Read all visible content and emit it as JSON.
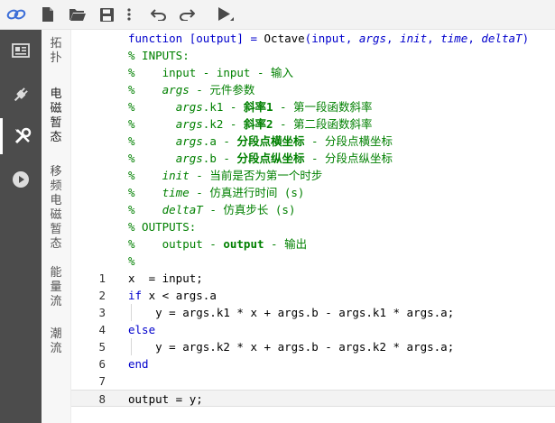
{
  "toolbar": {
    "items": [
      {
        "name": "link-icon"
      },
      {
        "name": "new-file-icon"
      },
      {
        "name": "open-folder-icon"
      },
      {
        "name": "save-icon"
      },
      {
        "name": "more-options-icon"
      },
      {
        "name": "undo-icon"
      },
      {
        "name": "redo-icon"
      },
      {
        "name": "run-icon"
      }
    ]
  },
  "sidebar": {
    "icons": [
      "layout-icon",
      "plug-icon",
      "tools-icon",
      "play-circle-icon"
    ],
    "tabs": [
      "拓扑",
      "电磁暂态",
      "移频电磁暂态",
      "能量流",
      "潮流"
    ]
  },
  "editor": {
    "header": [
      [
        {
          "t": "function [output] = ",
          "c": "kw"
        },
        {
          "t": "Octave",
          "c": "fn"
        },
        {
          "t": "(input, ",
          "c": "kw"
        },
        {
          "t": "args",
          "c": "kwi"
        },
        {
          "t": ", ",
          "c": "kw"
        },
        {
          "t": "init",
          "c": "kwi"
        },
        {
          "t": ", ",
          "c": "kw"
        },
        {
          "t": "time",
          "c": "kwi"
        },
        {
          "t": ", ",
          "c": "kw"
        },
        {
          "t": "deltaT",
          "c": "kwi"
        },
        {
          "t": ")",
          "c": "kw"
        }
      ],
      [
        {
          "t": "% INPUTS:",
          "c": "cm"
        }
      ],
      [
        {
          "t": "%    input - input - 输入",
          "c": "cm"
        }
      ],
      [
        {
          "t": "%    ",
          "c": "cm"
        },
        {
          "t": "args",
          "c": "cmi"
        },
        {
          "t": " - 元件参数",
          "c": "cm"
        }
      ],
      [
        {
          "t": "%      ",
          "c": "cm"
        },
        {
          "t": "args",
          "c": "cmi"
        },
        {
          "t": ".k1 - ",
          "c": "cm"
        },
        {
          "t": "斜率1",
          "c": "cmb"
        },
        {
          "t": " - 第一段函数斜率",
          "c": "cm"
        }
      ],
      [
        {
          "t": "%      ",
          "c": "cm"
        },
        {
          "t": "args",
          "c": "cmi"
        },
        {
          "t": ".k2 - ",
          "c": "cm"
        },
        {
          "t": "斜率2",
          "c": "cmb"
        },
        {
          "t": " - 第二段函数斜率",
          "c": "cm"
        }
      ],
      [
        {
          "t": "%      ",
          "c": "cm"
        },
        {
          "t": "args",
          "c": "cmi"
        },
        {
          "t": ".a - ",
          "c": "cm"
        },
        {
          "t": "分段点横坐标",
          "c": "cmb"
        },
        {
          "t": " - 分段点横坐标",
          "c": "cm"
        }
      ],
      [
        {
          "t": "%      ",
          "c": "cm"
        },
        {
          "t": "args",
          "c": "cmi"
        },
        {
          "t": ".b - ",
          "c": "cm"
        },
        {
          "t": "分段点纵坐标",
          "c": "cmb"
        },
        {
          "t": " - 分段点纵坐标",
          "c": "cm"
        }
      ],
      [
        {
          "t": "%    ",
          "c": "cm"
        },
        {
          "t": "init",
          "c": "cmi"
        },
        {
          "t": " - 当前是否为第一个时步",
          "c": "cm"
        }
      ],
      [
        {
          "t": "%    ",
          "c": "cm"
        },
        {
          "t": "time",
          "c": "cmi"
        },
        {
          "t": " - 仿真进行时间 (s)",
          "c": "cm"
        }
      ],
      [
        {
          "t": "%    ",
          "c": "cm"
        },
        {
          "t": "deltaT",
          "c": "cmi"
        },
        {
          "t": " - 仿真步长 (s)",
          "c": "cm"
        }
      ],
      [
        {
          "t": "% OUTPUTS:",
          "c": "cm"
        }
      ],
      [
        {
          "t": "%    output - ",
          "c": "cm"
        },
        {
          "t": "output",
          "c": "cmb"
        },
        {
          "t": " - 输出",
          "c": "cm"
        }
      ],
      [
        {
          "t": "%",
          "c": "cm"
        }
      ]
    ],
    "lines": [
      {
        "num": "1",
        "code": "x  = input;"
      },
      {
        "num": "2",
        "code": "if x < args.a",
        "kw": "if"
      },
      {
        "num": "3",
        "code": "    y = args.k1 * x + args.b - args.k1 * args.a;"
      },
      {
        "num": "4",
        "code": "else",
        "kw": "else"
      },
      {
        "num": "5",
        "code": "    y = args.k2 * x + args.b - args.k2 * args.a;"
      },
      {
        "num": "6",
        "code": "end",
        "kw": "end"
      },
      {
        "num": "7",
        "code": ""
      },
      {
        "num": "8",
        "code": "output = y;"
      }
    ],
    "current_line": "8"
  }
}
